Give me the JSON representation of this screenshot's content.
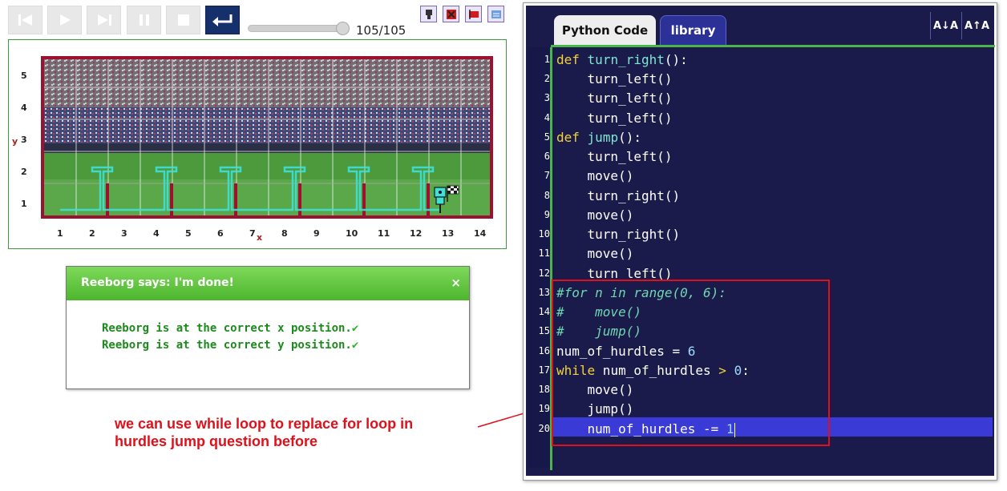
{
  "toolbar": {
    "buttons": [
      {
        "name": "first-step-button",
        "icon": "skip-back-icon"
      },
      {
        "name": "play-button",
        "icon": "play-icon"
      },
      {
        "name": "next-step-button",
        "icon": "skip-forward-icon"
      },
      {
        "name": "pause-button",
        "icon": "pause-icon"
      },
      {
        "name": "stop-button",
        "icon": "stop-icon"
      },
      {
        "name": "reload-button",
        "icon": "return-icon"
      }
    ],
    "step_counter": "105/105",
    "step_progress": 1.0,
    "mini_icons": [
      "robot-icon",
      "red-x-icon",
      "red-flag-icon",
      "edit-world-icon"
    ]
  },
  "world": {
    "y_ticks": [
      "5",
      "4",
      "3",
      "2",
      "1"
    ],
    "x_ticks": [
      "1",
      "2",
      "3",
      "4",
      "5",
      "6",
      "7",
      "8",
      "9",
      "10",
      "11",
      "12",
      "13",
      "14"
    ],
    "y_axis_letter": "y",
    "x_axis_letter": "x",
    "background": "baseball-stadium-image",
    "robot_icon": "reeborg-robot-icon",
    "goal_icon": "checkered-flag-icon"
  },
  "dialog": {
    "title": "Reeborg says: I'm done!",
    "close_label": "×",
    "lines": [
      "Reeborg is at the correct x position.",
      "Reeborg is at the correct y position."
    ],
    "check_icon": "✔"
  },
  "annotation": {
    "text_line1": "we can use while loop to replace for loop in",
    "text_line2": "hurdles jump question before"
  },
  "editor": {
    "tabs": {
      "python_code": "Python Code",
      "library": "library"
    },
    "font_decrease": "A↓A",
    "font_increase": "A↑A",
    "line_numbers": [
      "1",
      "2",
      "3",
      "4",
      "5",
      "6",
      "7",
      "8",
      "9",
      "10",
      "11",
      "12",
      "13",
      "14",
      "15",
      "16",
      "17",
      "18",
      "19",
      "20"
    ],
    "code": [
      "def turn_right():",
      "    turn_left()",
      "    turn_left()",
      "    turn_left()",
      "def jump():",
      "    turn_left()",
      "    move()",
      "    turn_right()",
      "    move()",
      "    turn_right()",
      "    move()",
      "    turn_left()",
      "#for n in range(0, 6):",
      "#    move()",
      "#    jump()",
      "num_of_hurdles = 6",
      "while num_of_hurdles > 0:",
      "    move()",
      "    jump()",
      "    num_of_hurdles -= 1"
    ],
    "current_line": 20,
    "colors": {
      "keyword": "#f5d23a",
      "function": "#7fe8d2",
      "comment": "#6fd8b0",
      "background": "#1a1b4b"
    }
  }
}
